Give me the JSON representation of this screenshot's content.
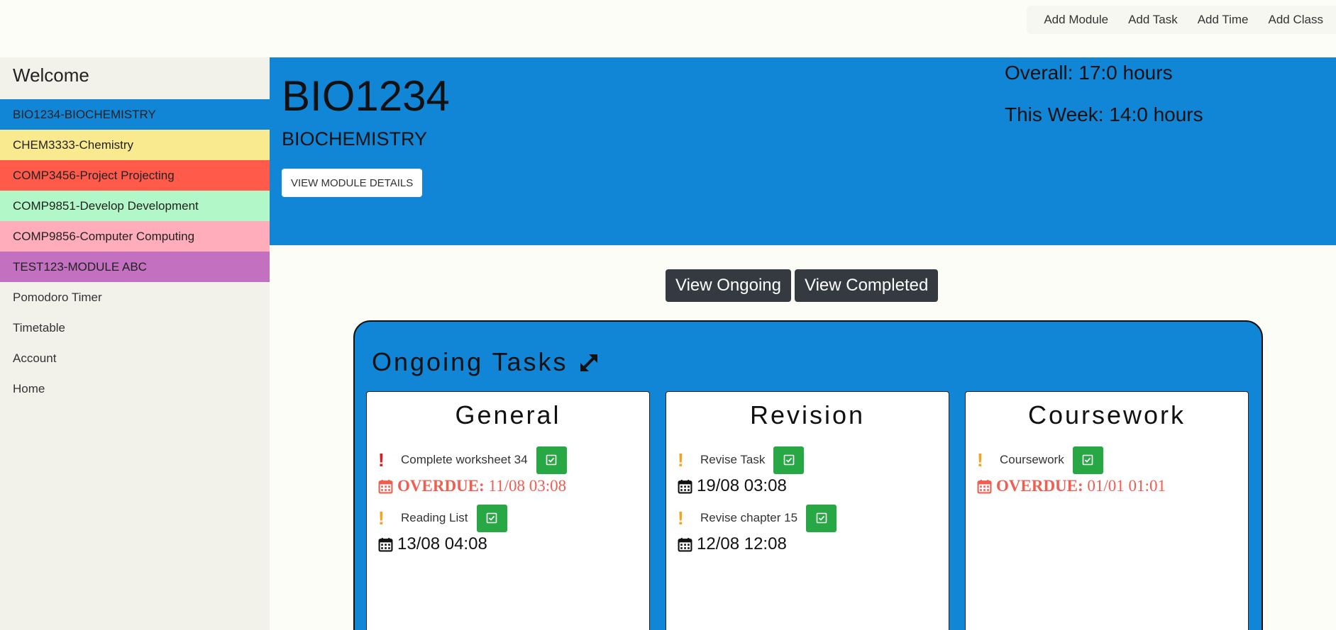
{
  "topnav": {
    "links": [
      "Add Module",
      "Add Task",
      "Add Time",
      "Add Class"
    ]
  },
  "sidebar": {
    "welcome": "Welcome",
    "modules": [
      {
        "label": "BIO1234-BIOCHEMISTRY",
        "color": "#1185d6"
      },
      {
        "label": "CHEM3333-Chemistry",
        "color": "#f9e98f"
      },
      {
        "label": "COMP3456-Project Projecting",
        "color": "#ff5a4a"
      },
      {
        "label": "COMP9851-Develop Development",
        "color": "#b2f7c7"
      },
      {
        "label": "COMP9856-Computer Computing",
        "color": "#ffadbb"
      },
      {
        "label": "TEST123-MODULE ABC",
        "color": "#c370c0"
      }
    ],
    "links": [
      "Pomodoro Timer",
      "Timetable",
      "Account",
      "Home"
    ]
  },
  "header": {
    "code": "BIO1234",
    "name": "BIOCHEMISTRY",
    "details_button": "VIEW MODULE DETAILS",
    "overall": "Overall: 17:0 hours",
    "week": "This Week: 14:0 hours",
    "color": "#1185d6"
  },
  "view_buttons": {
    "ongoing": "View Ongoing",
    "completed": "View Completed"
  },
  "tasks_panel": {
    "title": "Ongoing Tasks",
    "columns": [
      {
        "title": "General",
        "tasks": [
          {
            "name": "Complete worksheet 34",
            "priority": "high",
            "overdue_label": "OVERDUE:",
            "due": "11/08 03:08",
            "overdue": true
          },
          {
            "name": "Reading List",
            "priority": "medium",
            "due": "13/08 04:08",
            "overdue": false
          }
        ]
      },
      {
        "title": "Revision",
        "tasks": [
          {
            "name": "Revise Task",
            "priority": "medium",
            "due": "19/08 03:08",
            "overdue": false
          },
          {
            "name": "Revise chapter 15",
            "priority": "medium",
            "due": "12/08 12:08",
            "overdue": false
          }
        ]
      },
      {
        "title": "Coursework",
        "tasks": [
          {
            "name": "Coursework",
            "priority": "medium",
            "overdue_label": "OVERDUE:",
            "due": "01/01 01:01",
            "overdue": true
          }
        ]
      }
    ]
  },
  "colors": {
    "priority_high": "#e8141b",
    "priority_medium": "#f5a31a",
    "overdue": "#f25d50",
    "check": "#28a745"
  }
}
